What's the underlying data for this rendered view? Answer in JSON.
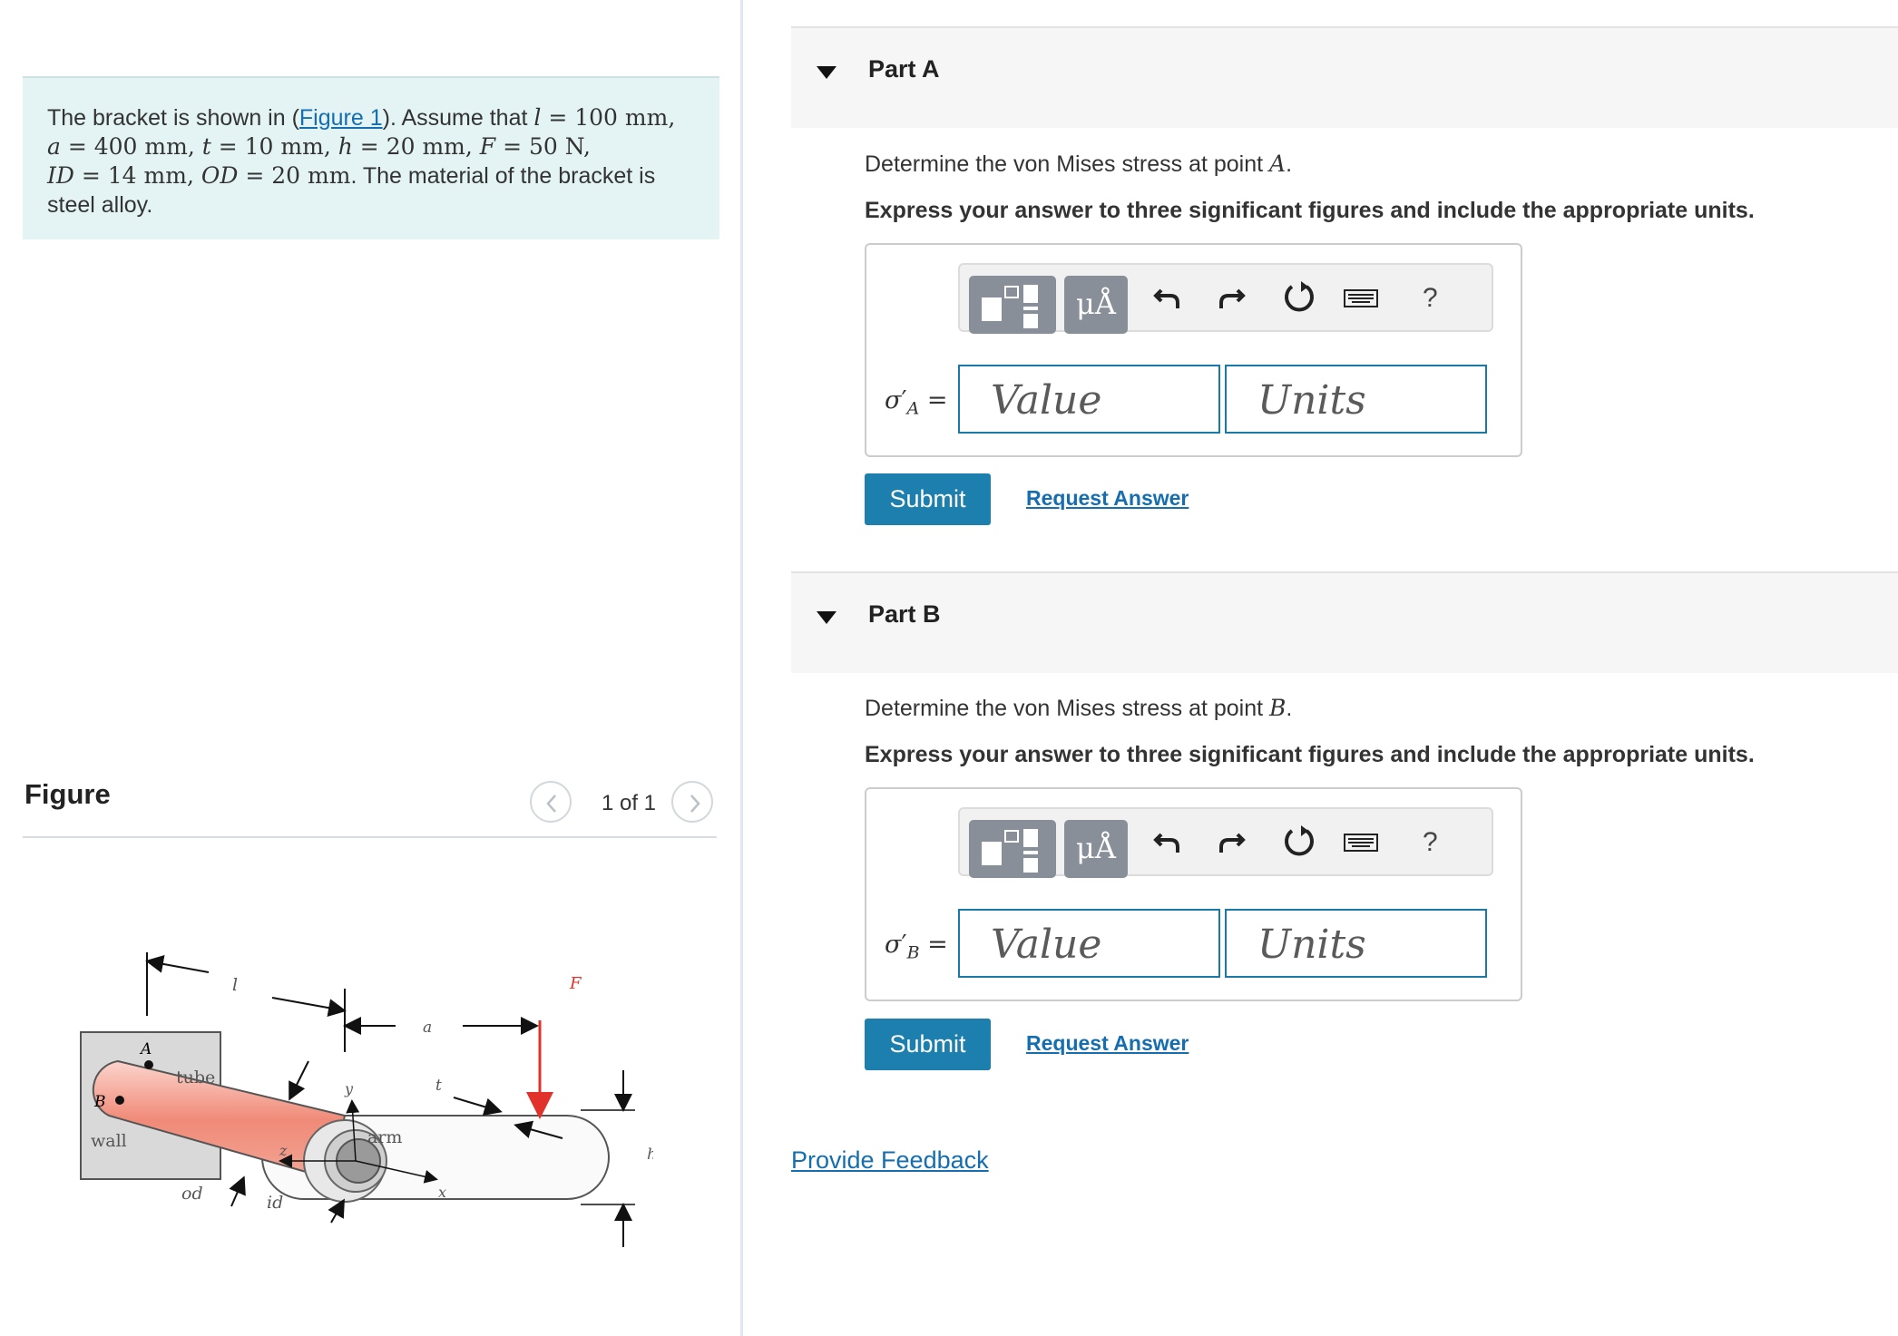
{
  "problem": {
    "figure_link": "Figure 1",
    "text_parts": [
      "The bracket is shown in (",
      "). Assume that ",
      ". The material of the bracket is steel alloy."
    ],
    "given_values": [
      {
        "symbol": "l",
        "value": "100",
        "unit": "mm"
      },
      {
        "symbol": "a",
        "value": "400",
        "unit": "mm"
      },
      {
        "symbol": "t",
        "value": "10",
        "unit": "mm"
      },
      {
        "symbol": "h",
        "value": "20",
        "unit": "mm"
      },
      {
        "symbol": "F",
        "value": "50",
        "unit": "N"
      },
      {
        "symbol": "ID",
        "value": "14",
        "unit": "mm"
      },
      {
        "symbol": "OD",
        "value": "20",
        "unit": "mm"
      }
    ]
  },
  "figure": {
    "title": "Figure",
    "counter": "1 of 1",
    "labels": {
      "A": "A",
      "B": "B",
      "wall": "wall",
      "tube": "tube",
      "arm": "arm",
      "od": "od",
      "id": "id",
      "l": "l",
      "a": "a",
      "t": "t",
      "h": "h",
      "F": "F",
      "x": "x",
      "y": "y",
      "z": "z"
    }
  },
  "parts": [
    {
      "title": "Part A",
      "question_prefix": "Determine the von Mises stress at point ",
      "point": "A",
      "instruction": "Express your answer to three significant figures and include the appropriate units.",
      "variable_subscript": "A",
      "value_placeholder": "Value",
      "units_placeholder": "Units",
      "submit_label": "Submit",
      "request_label": "Request Answer"
    },
    {
      "title": "Part B",
      "question_prefix": "Determine the von Mises stress at point ",
      "point": "B",
      "instruction": "Express your answer to three significant figures and include the appropriate units.",
      "variable_subscript": "B",
      "value_placeholder": "Value",
      "units_placeholder": "Units",
      "submit_label": "Submit",
      "request_label": "Request Answer"
    }
  ],
  "toolbar": {
    "units_button_label": "μÅ",
    "help_label": "?",
    "icons": [
      "templates-icon",
      "units-icon",
      "undo-icon",
      "redo-icon",
      "reset-icon",
      "keyboard-icon",
      "help-icon"
    ]
  },
  "feedback_link": "Provide Feedback",
  "colors": {
    "accent": "#1d7fae",
    "link": "#146eb0",
    "problem_bg": "#e4f4f4",
    "tube_fill": "#f08a78",
    "force_arrow": "#e0322a"
  }
}
